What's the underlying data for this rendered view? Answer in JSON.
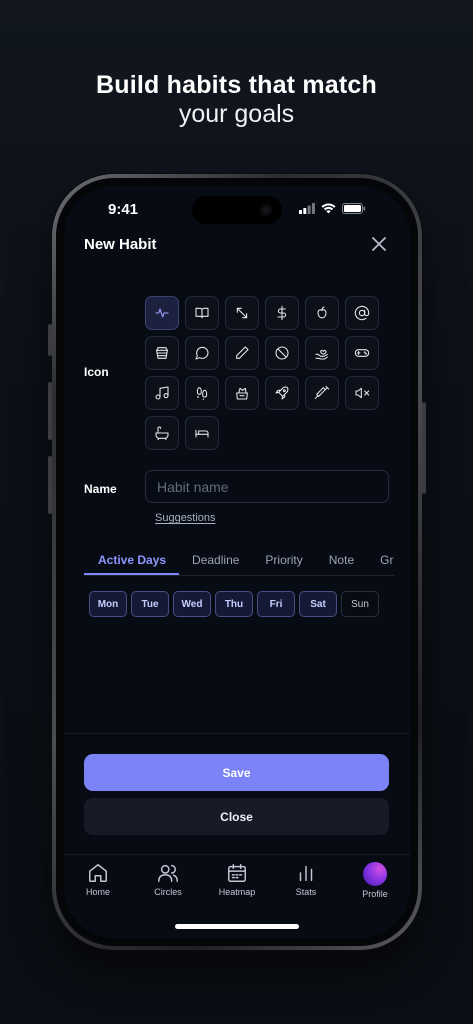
{
  "headline": {
    "line1": "Build habits that match",
    "line2": "your goals"
  },
  "status": {
    "time": "9:41"
  },
  "sheet": {
    "title": "New Habit"
  },
  "icon_section": {
    "label": "Icon",
    "icons": [
      "activity-icon",
      "book-icon",
      "arrows-diagonal-icon",
      "dollar-icon",
      "apple-icon",
      "at-sign-icon",
      "cake-icon",
      "chat-bubble-icon",
      "pencil-icon",
      "prohibited-icon",
      "heart-hand-icon",
      "gamepad-icon",
      "music-note-icon",
      "footprints-icon",
      "dumbbell-icon",
      "rocket-icon",
      "syringe-icon",
      "volume-mute-icon",
      "bathtub-icon",
      "bed-icon"
    ],
    "selected": "activity-icon"
  },
  "name_section": {
    "label": "Name",
    "placeholder": "Habit name",
    "value": "",
    "suggestions_link": "Suggestions"
  },
  "tabs": [
    "Active Days",
    "Deadline",
    "Priority",
    "Note",
    "Gro"
  ],
  "active_tab": "Active Days",
  "days": [
    {
      "label": "Mon",
      "active": true
    },
    {
      "label": "Tue",
      "active": true
    },
    {
      "label": "Wed",
      "active": true
    },
    {
      "label": "Thu",
      "active": true
    },
    {
      "label": "Fri",
      "active": true
    },
    {
      "label": "Sat",
      "active": true
    },
    {
      "label": "Sun",
      "active": false
    }
  ],
  "buttons": {
    "save": "Save",
    "close": "Close"
  },
  "nav": [
    "Home",
    "Circles",
    "Heatmap",
    "Stats",
    "Profile"
  ],
  "colors": {
    "accent": "#7b83f6",
    "background": "#070b14",
    "selected_day_bg": "#141a35"
  }
}
